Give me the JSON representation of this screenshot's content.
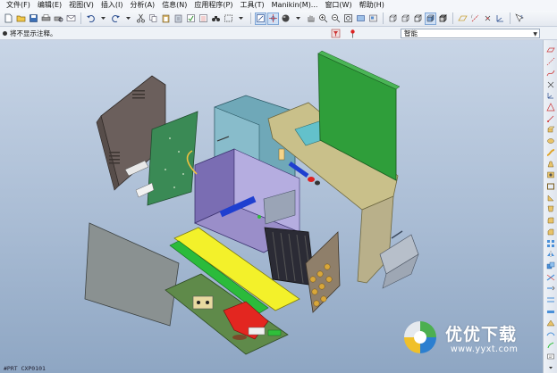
{
  "menu": [
    {
      "label": "文件(F)"
    },
    {
      "label": "编辑(E)"
    },
    {
      "label": "视图(V)"
    },
    {
      "label": "插入(I)"
    },
    {
      "label": "分析(A)"
    },
    {
      "label": "信息(N)"
    },
    {
      "label": "应用程序(P)"
    },
    {
      "label": "工具(T)"
    },
    {
      "label": "Manikin(M)..."
    },
    {
      "label": "窗口(W)"
    },
    {
      "label": "帮助(H)"
    }
  ],
  "status": {
    "message": "将不显示注释。"
  },
  "filter": {
    "selected": "智能"
  },
  "viewport": {
    "coord_readout": "#PRT CXP0101"
  },
  "watermark": {
    "brand": "优优下载",
    "url": "www.yyxt.com"
  },
  "colors": {
    "viewport_top": "#c8d5e6",
    "viewport_bottom": "#8ea6c3",
    "pcb_green": "#2f9e3a",
    "bar_yellow": "#f3f12a",
    "panel_purple": "#9a8ec9",
    "panel_teal": "#6fa8b8",
    "panel_tan": "#c9c08a",
    "chip_red": "#e32620",
    "bar_blue": "#1f3fd0",
    "watermark_green": "#4caf50",
    "watermark_blue": "#2b7fd0"
  }
}
